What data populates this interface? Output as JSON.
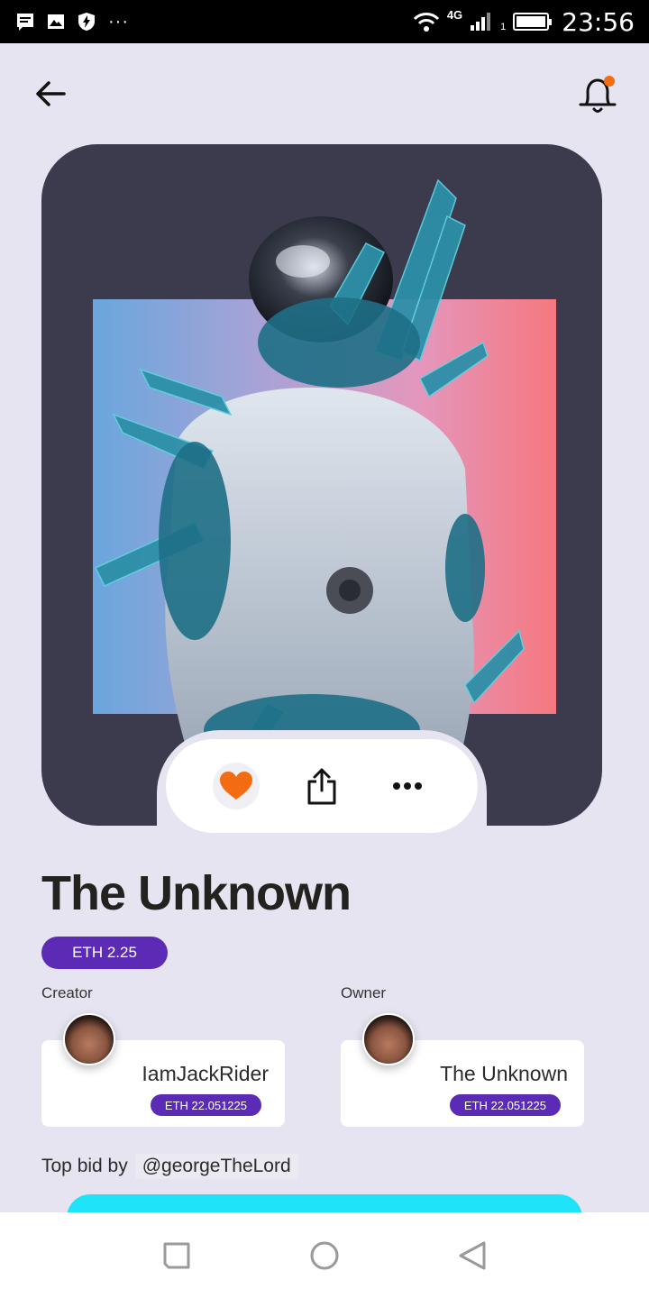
{
  "status_bar": {
    "time": "23:56",
    "network": "4G",
    "sim": "1"
  },
  "header": {
    "back_icon": "arrow-left-icon",
    "bell_icon": "bell-icon",
    "notification_dot_color": "#f36c12"
  },
  "artwork": {
    "description_icon": "astronaut-crystal-artwork",
    "actions": {
      "like_icon": "heart-icon",
      "like_color": "#f36c12",
      "share_icon": "share-icon",
      "more_icon": "more-dots-icon"
    }
  },
  "nft": {
    "title": "The Unknown",
    "price": "ETH 2.25"
  },
  "creator": {
    "label": "Creator",
    "name": "IamJackRider",
    "eth": "ETH 22.051225"
  },
  "owner": {
    "label": "Owner",
    "name": "The Unknown",
    "eth": "ETH 22.051225"
  },
  "top_bid": {
    "prefix": "Top bid by",
    "bidder": "@georgeTheLord"
  },
  "colors": {
    "accent": "#5b2bb5",
    "cta": "#1fe3f8",
    "background": "#e6e4f0"
  }
}
